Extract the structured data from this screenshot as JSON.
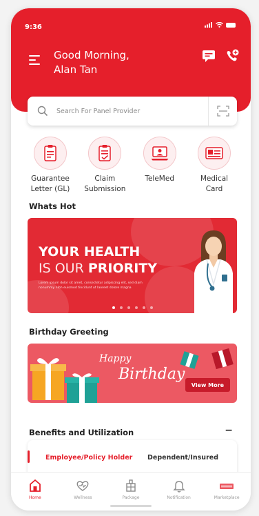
{
  "status_bar": {
    "time": "9:36"
  },
  "header": {
    "greeting_line1": "Good Morning,",
    "greeting_line2": "Alan Tan"
  },
  "search": {
    "placeholder": "Search For Panel Provider"
  },
  "services": [
    {
      "label_line1": "Guarantee",
      "label_line2": "Letter (GL)"
    },
    {
      "label_line1": "Claim",
      "label_line2": "Submission"
    },
    {
      "label_line1": "TeleMed",
      "label_line2": ""
    },
    {
      "label_line1": "Medical",
      "label_line2": "Card"
    }
  ],
  "whats_hot": {
    "title": "Whats Hot",
    "banner_line1": "YOUR HEALTH",
    "banner_line2_thin": "IS OUR",
    "banner_line2_bold": "PRIORITY",
    "banner_body": "Lorem ipsum dolor sit amet, consectetur adipiscing elit, sed diam nonummy nibh euismod tincidunt ut laoreet dolore magna",
    "carousel_active": 0
  },
  "birthday": {
    "title": "Birthday Greeting",
    "happy": "Happy",
    "birthday": "Birthday",
    "view_more": "View More"
  },
  "benefits": {
    "title": "Benefits and Utilization",
    "collapse_symbol": "−",
    "tab_active": "Employee/Policy Holder",
    "tab_inactive": "Dependent/Insured"
  },
  "bottom_nav": [
    {
      "label": "Home",
      "icon": "home-icon",
      "active": true
    },
    {
      "label": "Wellness",
      "icon": "wellness-icon",
      "active": false
    },
    {
      "label": "Package",
      "icon": "package-icon",
      "active": false
    },
    {
      "label": "Notification",
      "icon": "bell-icon",
      "active": false
    },
    {
      "label": "Marketplace",
      "icon": "marketplace-icon",
      "active": false
    }
  ],
  "colors": {
    "primary": "#e51f2b",
    "banner": "#e22a34",
    "birthday_bg": "#ec5963"
  }
}
